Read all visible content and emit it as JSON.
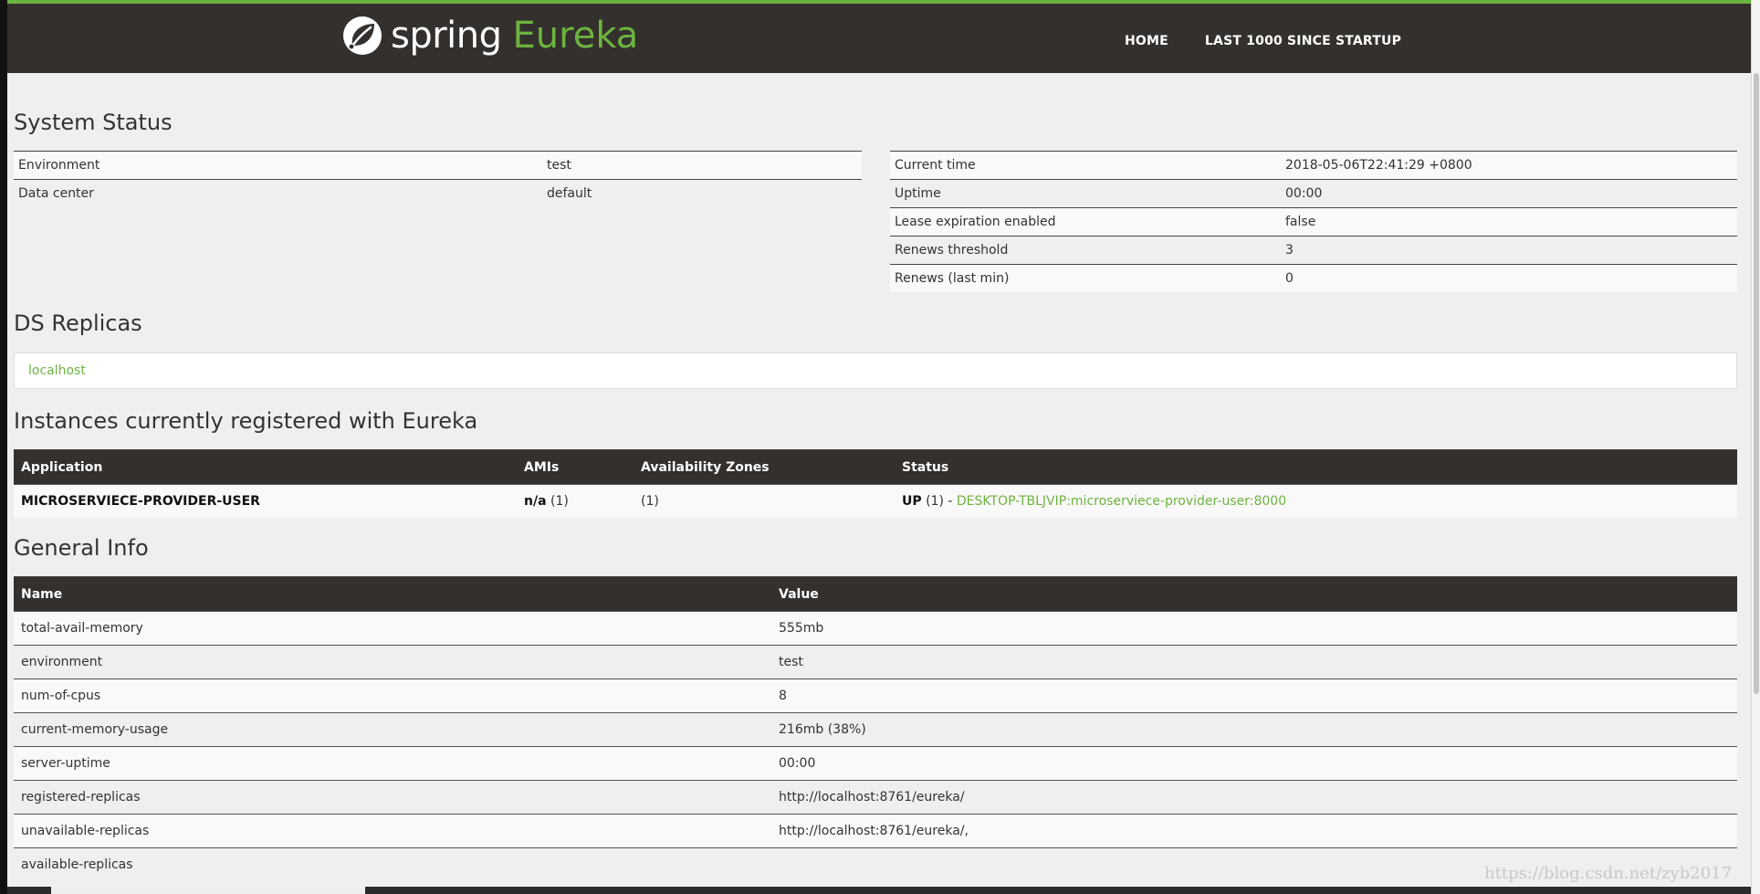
{
  "header": {
    "brand_spring": "spring",
    "brand_eureka": "Eureka",
    "brand_icon": "spring-leaf-icon",
    "nav": [
      "HOME",
      "LAST 1000 SINCE STARTUP"
    ],
    "accent_color": "#6db33f",
    "bar_color": "#34302d"
  },
  "system_status": {
    "title": "System Status",
    "left": [
      {
        "label": "Environment",
        "value": "test"
      },
      {
        "label": "Data center",
        "value": "default"
      }
    ],
    "right": [
      {
        "label": "Current time",
        "value": "2018-05-06T22:41:29 +0800"
      },
      {
        "label": "Uptime",
        "value": "00:00"
      },
      {
        "label": "Lease expiration enabled",
        "value": "false"
      },
      {
        "label": "Renews threshold",
        "value": "3"
      },
      {
        "label": "Renews (last min)",
        "value": "0"
      }
    ]
  },
  "ds_replicas": {
    "title": "DS Replicas",
    "items": [
      "localhost"
    ]
  },
  "instances": {
    "title": "Instances currently registered with Eureka",
    "columns": [
      "Application",
      "AMIs",
      "Availability Zones",
      "Status"
    ],
    "rows": [
      {
        "application": "MICROSERVIECE-PROVIDER-USER",
        "amis_label": "n/a",
        "amis_count": "(1)",
        "zones": "(1)",
        "status_label": "UP",
        "status_count": "(1) -",
        "instance_link": "DESKTOP-TBLJVIP:microserviece-provider-user:8000"
      }
    ]
  },
  "general_info": {
    "title": "General Info",
    "columns": [
      "Name",
      "Value"
    ],
    "rows": [
      {
        "name": "total-avail-memory",
        "value": "555mb"
      },
      {
        "name": "environment",
        "value": "test"
      },
      {
        "name": "num-of-cpus",
        "value": "8"
      },
      {
        "name": "current-memory-usage",
        "value": "216mb (38%)"
      },
      {
        "name": "server-uptime",
        "value": "00:00"
      },
      {
        "name": "registered-replicas",
        "value": "http://localhost:8761/eureka/"
      },
      {
        "name": "unavailable-replicas",
        "value": "http://localhost:8761/eureka/,"
      },
      {
        "name": "available-replicas",
        "value": ""
      }
    ]
  },
  "watermark": "https://blog.csdn.net/zyb2017"
}
